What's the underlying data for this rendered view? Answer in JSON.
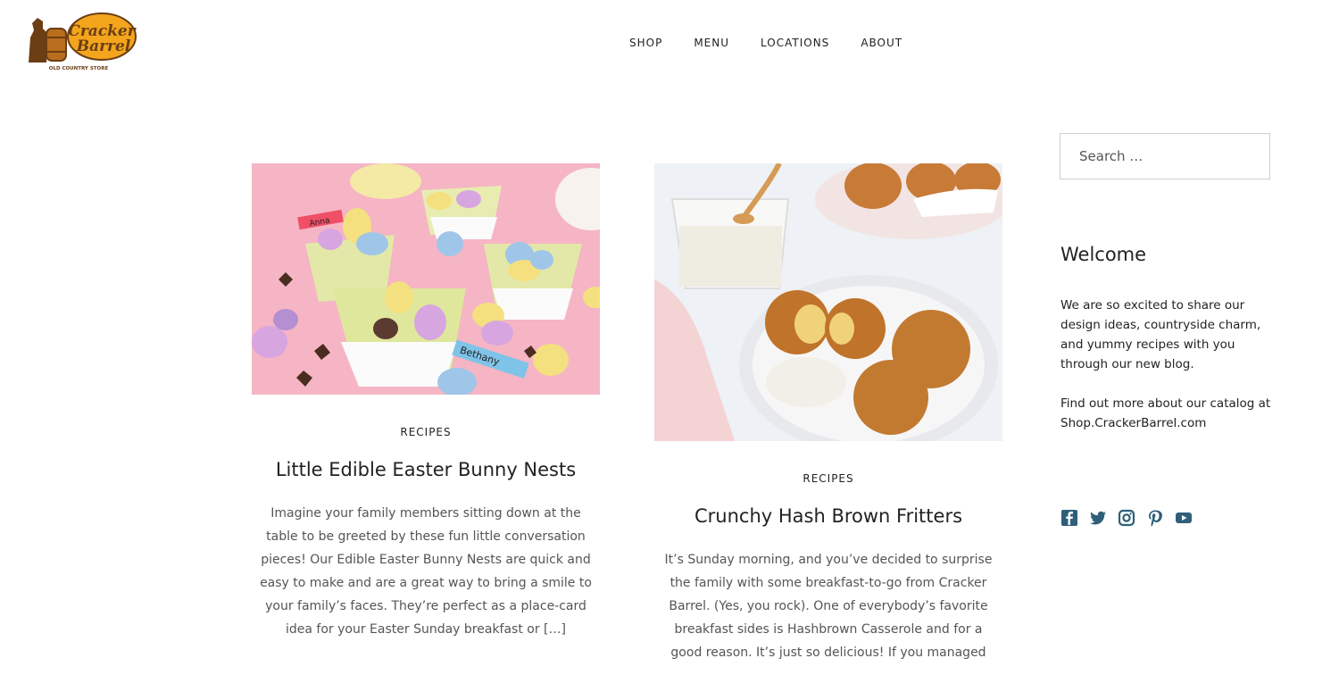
{
  "brand": {
    "name_line1": "Cracker",
    "name_line2": "Barrel",
    "tagline": "OLD COUNTRY STORE",
    "color": "#f3a51c"
  },
  "nav": [
    {
      "label": "SHOP"
    },
    {
      "label": "MENU"
    },
    {
      "label": "LOCATIONS"
    },
    {
      "label": "ABOUT"
    }
  ],
  "posts": [
    {
      "category": "RECIPES",
      "title": "Little Edible Easter Bunny Nests",
      "excerpt": "Imagine your family members sitting down at the table to be greeted by these fun little conversation pieces!   Our Edible Easter Bunny Nests are quick and easy to make and are a great way to bring a smile to your family’s faces. They’re perfect as a place-card idea for your Easter Sunday breakfast or […]",
      "image_labels": [
        "Anna",
        "Bethany"
      ]
    },
    {
      "category": "RECIPES",
      "title": "Crunchy Hash Brown Fritters",
      "excerpt": "It’s Sunday morning, and you’ve decided to surprise the family with some breakfast-to-go from Cracker Barrel.  (Yes, you rock).   One of everybody’s favorite breakfast sides is Hashbrown Casserole and for a good reason. It’s just so delicious! If you managed"
    }
  ],
  "sidebar": {
    "search_placeholder": "Search …",
    "welcome_title": "Welcome",
    "welcome_p1": "We are so excited to share our design ideas, countryside charm, and yummy recipes with you through our new blog.",
    "welcome_p2": "Find out more about our catalog at Shop.CrackerBarrel.com",
    "social": [
      "facebook-icon",
      "twitter-icon",
      "instagram-icon",
      "pinterest-icon",
      "youtube-icon"
    ],
    "icon_color": "#2f5f7a"
  }
}
